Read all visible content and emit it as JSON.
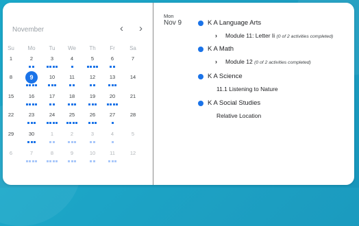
{
  "calendar": {
    "month_label": "November",
    "prev_icon": "chevron-left-icon",
    "next_icon": "chevron-right-icon",
    "prev_glyph": "‹",
    "next_glyph": "›",
    "weekdays": [
      "Su",
      "Mo",
      "Tu",
      "We",
      "Th",
      "Fr",
      "Sa"
    ],
    "selected_day": "9",
    "weeks": [
      [
        {
          "d": "1"
        },
        {
          "d": "2",
          "dots": 2
        },
        {
          "d": "3",
          "dots": 4
        },
        {
          "d": "4",
          "dots": 1
        },
        {
          "d": "5",
          "dots": 4
        },
        {
          "d": "6",
          "dots": 2
        },
        {
          "d": "7"
        }
      ],
      [
        {
          "d": "8"
        },
        {
          "d": "9",
          "dots": 4
        },
        {
          "d": "10",
          "dots": 3
        },
        {
          "d": "11",
          "dots": 2
        },
        {
          "d": "12",
          "dots": 2
        },
        {
          "d": "13",
          "dots": 3
        },
        {
          "d": "14"
        }
      ],
      [
        {
          "d": "15"
        },
        {
          "d": "16",
          "dots": 4
        },
        {
          "d": "17",
          "dots": 2
        },
        {
          "d": "18",
          "dots": 3
        },
        {
          "d": "19",
          "dots": 3
        },
        {
          "d": "20",
          "dots": 4
        },
        {
          "d": "21"
        }
      ],
      [
        {
          "d": "22"
        },
        {
          "d": "23",
          "dots": 3
        },
        {
          "d": "24",
          "dots": 4
        },
        {
          "d": "25",
          "dots": 4
        },
        {
          "d": "26",
          "dots": 3
        },
        {
          "d": "27",
          "dots": 1
        },
        {
          "d": "28"
        }
      ],
      [
        {
          "d": "29"
        },
        {
          "d": "30",
          "dots": 3
        },
        {
          "d": "1",
          "dim": true,
          "dots": 2
        },
        {
          "d": "2",
          "dim": true,
          "dots": 3
        },
        {
          "d": "3",
          "dim": true,
          "dots": 2
        },
        {
          "d": "4",
          "dim": true,
          "dots": 1
        },
        {
          "d": "5",
          "dim": true
        }
      ],
      [
        {
          "d": "6",
          "dim": true
        },
        {
          "d": "7",
          "dim": true,
          "dots": 4
        },
        {
          "d": "8",
          "dim": true,
          "dots": 4
        },
        {
          "d": "9",
          "dim": true,
          "dots": 3
        },
        {
          "d": "10",
          "dim": true,
          "dots": 2
        },
        {
          "d": "11",
          "dim": true,
          "dots": 3
        },
        {
          "d": "12",
          "dim": true
        }
      ]
    ]
  },
  "agenda": {
    "day_of_week": "Mon",
    "date": "Nov 9",
    "accent": "#1a73e8",
    "courses": [
      {
        "name": "K A Language Arts",
        "activity": "Module 11: Letter Ii",
        "meta": "(0 of 2 activities completed)",
        "expandable": true
      },
      {
        "name": "K A Math",
        "activity": "Module 12",
        "meta": "(0 of 2 activities completed)",
        "expandable": true
      },
      {
        "name": "K A Science",
        "activity": "11.1 Listening to Nature",
        "meta": "",
        "expandable": false
      },
      {
        "name": "K A Social Studies",
        "activity": "Relative Location",
        "meta": "",
        "expandable": false
      }
    ]
  }
}
